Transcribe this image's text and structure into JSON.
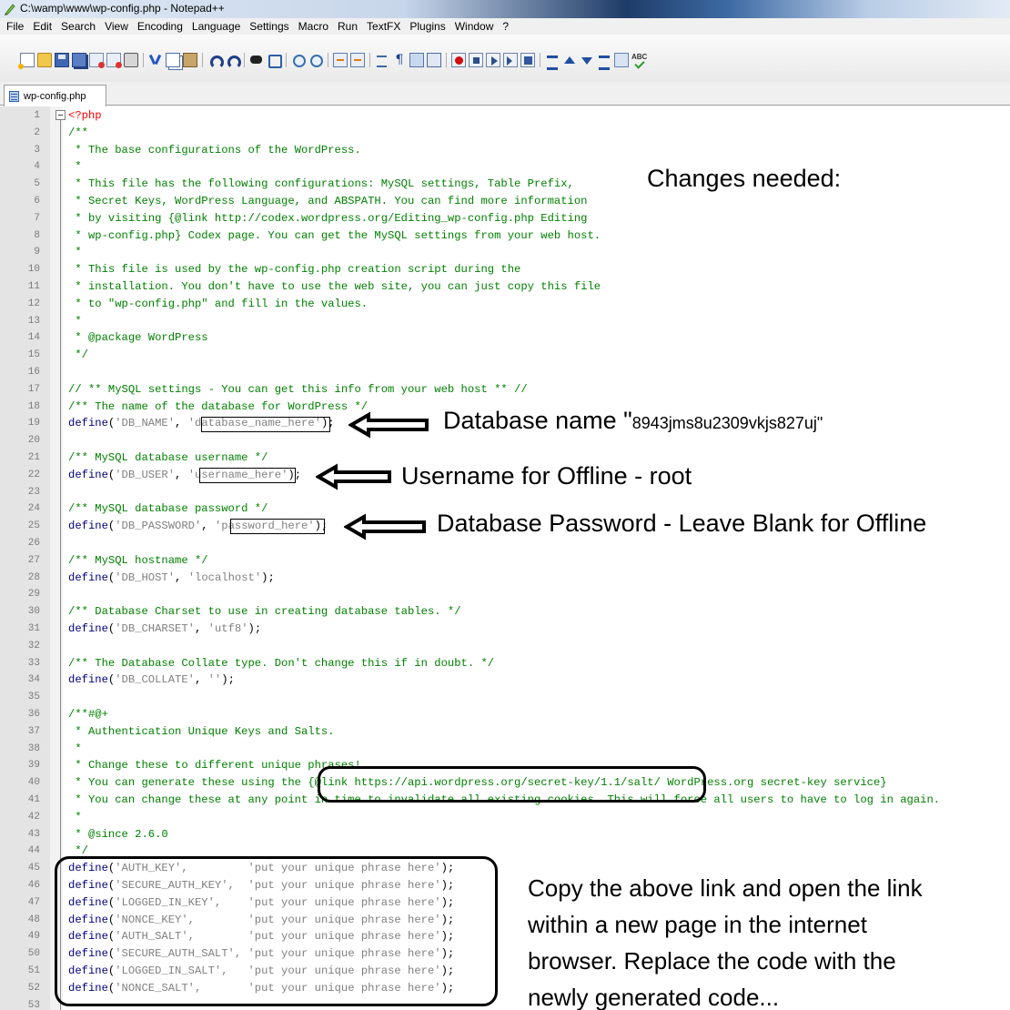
{
  "window": {
    "title": "C:\\wamp\\www\\wp-config.php - Notepad++"
  },
  "menu": [
    "File",
    "Edit",
    "Search",
    "View",
    "Encoding",
    "Language",
    "Settings",
    "Macro",
    "Run",
    "TextFX",
    "Plugins",
    "Window",
    "?"
  ],
  "toolbar": {
    "icons": [
      "new-file-icon",
      "open-file-icon",
      "save-icon",
      "save-all-icon",
      "close-icon",
      "close-all-icon",
      "print-icon",
      "cut-icon",
      "copy-icon",
      "paste-icon",
      "undo-icon",
      "redo-icon",
      "find-icon",
      "replace-icon",
      "zoom-in-icon",
      "zoom-out-icon",
      "sync-vertical-icon",
      "sync-horizontal-icon",
      "word-wrap-icon",
      "show-all-chars-icon",
      "indent-guide-icon",
      "user-language-icon",
      "record-macro-icon",
      "stop-macro-icon",
      "play-macro-icon",
      "run-macro-multiple-icon",
      "save-macro-icon",
      "sort-icon",
      "move-up-icon",
      "move-down-icon",
      "sort-lines-icon",
      "clipboard-icon",
      "spell-check-icon"
    ]
  },
  "tab": {
    "label": "wp-config.php"
  },
  "editor": {
    "lines": [
      {
        "n": "1",
        "parts": [
          [
            "php",
            "<?php"
          ]
        ]
      },
      {
        "n": "2",
        "parts": [
          [
            "comment",
            "/**"
          ]
        ]
      },
      {
        "n": "3",
        "parts": [
          [
            "comment",
            " * The base configurations of the WordPress."
          ]
        ]
      },
      {
        "n": "4",
        "parts": [
          [
            "comment",
            " *"
          ]
        ]
      },
      {
        "n": "5",
        "parts": [
          [
            "comment",
            " * This file has the following configurations: MySQL settings, Table Prefix,"
          ]
        ]
      },
      {
        "n": "6",
        "parts": [
          [
            "comment",
            " * Secret Keys, WordPress Language, and ABSPATH. You can find more information"
          ]
        ]
      },
      {
        "n": "7",
        "parts": [
          [
            "comment",
            " * by visiting {@link http://codex.wordpress.org/Editing_wp-config.php Editing"
          ]
        ]
      },
      {
        "n": "8",
        "parts": [
          [
            "comment",
            " * wp-config.php} Codex page. You can get the MySQL settings from your web host."
          ]
        ]
      },
      {
        "n": "9",
        "parts": [
          [
            "comment",
            " *"
          ]
        ]
      },
      {
        "n": "10",
        "parts": [
          [
            "comment",
            " * This file is used by the wp-config.php creation script during the"
          ]
        ]
      },
      {
        "n": "11",
        "parts": [
          [
            "comment",
            " * installation. You don't have to use the web site, you can just copy this file"
          ]
        ]
      },
      {
        "n": "12",
        "parts": [
          [
            "comment",
            " * to \"wp-config.php\" and fill in the values."
          ]
        ]
      },
      {
        "n": "13",
        "parts": [
          [
            "comment",
            " *"
          ]
        ]
      },
      {
        "n": "14",
        "parts": [
          [
            "comment",
            " * @package WordPress"
          ]
        ]
      },
      {
        "n": "15",
        "parts": [
          [
            "comment",
            " */"
          ]
        ]
      },
      {
        "n": "16",
        "parts": []
      },
      {
        "n": "17",
        "parts": [
          [
            "comment",
            "// ** MySQL settings - You can get this info from your web host ** //"
          ]
        ]
      },
      {
        "n": "18",
        "parts": [
          [
            "comment",
            "/** The name of the database for WordPress */"
          ]
        ]
      },
      {
        "n": "19",
        "parts": [
          [
            "kw",
            "define"
          ],
          [
            "plain",
            "("
          ],
          [
            "str",
            "'DB_NAME'"
          ],
          [
            "plain",
            ", "
          ],
          [
            "str",
            "'database_name_here'"
          ],
          [
            "plain",
            ");"
          ]
        ]
      },
      {
        "n": "20",
        "parts": []
      },
      {
        "n": "21",
        "parts": [
          [
            "comment",
            "/** MySQL database username */"
          ]
        ]
      },
      {
        "n": "22",
        "parts": [
          [
            "kw",
            "define"
          ],
          [
            "plain",
            "("
          ],
          [
            "str",
            "'DB_USER'"
          ],
          [
            "plain",
            ", "
          ],
          [
            "str",
            "'username_here'"
          ],
          [
            "plain",
            ");"
          ]
        ]
      },
      {
        "n": "23",
        "parts": []
      },
      {
        "n": "24",
        "parts": [
          [
            "comment",
            "/** MySQL database password */"
          ]
        ]
      },
      {
        "n": "25",
        "parts": [
          [
            "kw",
            "define"
          ],
          [
            "plain",
            "("
          ],
          [
            "str",
            "'DB_PASSWORD'"
          ],
          [
            "plain",
            ", "
          ],
          [
            "str",
            "'password_here'"
          ],
          [
            "plain",
            ");"
          ]
        ]
      },
      {
        "n": "26",
        "parts": []
      },
      {
        "n": "27",
        "parts": [
          [
            "comment",
            "/** MySQL hostname */"
          ]
        ]
      },
      {
        "n": "28",
        "parts": [
          [
            "kw",
            "define"
          ],
          [
            "plain",
            "("
          ],
          [
            "str",
            "'DB_HOST'"
          ],
          [
            "plain",
            ", "
          ],
          [
            "str",
            "'localhost'"
          ],
          [
            "plain",
            ");"
          ]
        ]
      },
      {
        "n": "29",
        "parts": []
      },
      {
        "n": "30",
        "parts": [
          [
            "comment",
            "/** Database Charset to use in creating database tables. */"
          ]
        ]
      },
      {
        "n": "31",
        "parts": [
          [
            "kw",
            "define"
          ],
          [
            "plain",
            "("
          ],
          [
            "str",
            "'DB_CHARSET'"
          ],
          [
            "plain",
            ", "
          ],
          [
            "str",
            "'utf8'"
          ],
          [
            "plain",
            ");"
          ]
        ]
      },
      {
        "n": "32",
        "parts": []
      },
      {
        "n": "33",
        "parts": [
          [
            "comment",
            "/** The Database Collate type. Don't change this if in doubt. */"
          ]
        ]
      },
      {
        "n": "34",
        "parts": [
          [
            "kw",
            "define"
          ],
          [
            "plain",
            "("
          ],
          [
            "str",
            "'DB_COLLATE'"
          ],
          [
            "plain",
            ", "
          ],
          [
            "str",
            "''"
          ],
          [
            "plain",
            ");"
          ]
        ]
      },
      {
        "n": "35",
        "parts": []
      },
      {
        "n": "36",
        "parts": [
          [
            "comment",
            "/**#@+"
          ]
        ]
      },
      {
        "n": "37",
        "parts": [
          [
            "comment",
            " * Authentication Unique Keys and Salts."
          ]
        ]
      },
      {
        "n": "38",
        "parts": [
          [
            "comment",
            " *"
          ]
        ]
      },
      {
        "n": "39",
        "parts": [
          [
            "comment",
            " * Change these to different unique phrases!"
          ]
        ]
      },
      {
        "n": "40",
        "parts": [
          [
            "comment",
            " * You can generate these using the {@link https://api.wordpress.org/secret-key/1.1/salt/ WordPress.org secret-key service}"
          ]
        ]
      },
      {
        "n": "41",
        "parts": [
          [
            "comment",
            " * You can change these at any point in time to invalidate all existing cookies. This will force all users to have to log in again."
          ]
        ]
      },
      {
        "n": "42",
        "parts": [
          [
            "comment",
            " *"
          ]
        ]
      },
      {
        "n": "43",
        "parts": [
          [
            "comment",
            " * @since 2.6.0"
          ]
        ]
      },
      {
        "n": "44",
        "parts": [
          [
            "comment",
            " */"
          ]
        ]
      },
      {
        "n": "45",
        "parts": [
          [
            "kw",
            "define"
          ],
          [
            "plain",
            "("
          ],
          [
            "str",
            "'AUTH_KEY',         'put your unique phrase here'"
          ],
          [
            "plain",
            ");"
          ]
        ]
      },
      {
        "n": "46",
        "parts": [
          [
            "kw",
            "define"
          ],
          [
            "plain",
            "("
          ],
          [
            "str",
            "'SECURE_AUTH_KEY',  'put your unique phrase here'"
          ],
          [
            "plain",
            ");"
          ]
        ]
      },
      {
        "n": "47",
        "parts": [
          [
            "kw",
            "define"
          ],
          [
            "plain",
            "("
          ],
          [
            "str",
            "'LOGGED_IN_KEY',    'put your unique phrase here'"
          ],
          [
            "plain",
            ");"
          ]
        ]
      },
      {
        "n": "48",
        "parts": [
          [
            "kw",
            "define"
          ],
          [
            "plain",
            "("
          ],
          [
            "str",
            "'NONCE_KEY',        'put your unique phrase here'"
          ],
          [
            "plain",
            ");"
          ]
        ]
      },
      {
        "n": "49",
        "parts": [
          [
            "kw",
            "define"
          ],
          [
            "plain",
            "("
          ],
          [
            "str",
            "'AUTH_SALT',        'put your unique phrase here'"
          ],
          [
            "plain",
            ");"
          ]
        ]
      },
      {
        "n": "50",
        "parts": [
          [
            "kw",
            "define"
          ],
          [
            "plain",
            "("
          ],
          [
            "str",
            "'SECURE_AUTH_SALT', 'put your unique phrase here'"
          ],
          [
            "plain",
            ");"
          ]
        ]
      },
      {
        "n": "51",
        "parts": [
          [
            "kw",
            "define"
          ],
          [
            "plain",
            "("
          ],
          [
            "str",
            "'LOGGED_IN_SALT',   'put your unique phrase here'"
          ],
          [
            "plain",
            ");"
          ]
        ]
      },
      {
        "n": "52",
        "parts": [
          [
            "kw",
            "define"
          ],
          [
            "plain",
            "("
          ],
          [
            "str",
            "'NONCE_SALT',       'put your unique phrase here'"
          ],
          [
            "plain",
            ");"
          ]
        ]
      },
      {
        "n": "53",
        "parts": []
      }
    ]
  },
  "annotations": {
    "changes_needed": "Changes needed:",
    "db_name_label": "Database name \"",
    "db_name_value": "8943jms8u2309vkjs827uj\"",
    "username_note": "Username for Offline - root",
    "password_note": "Database Password - Leave Blank for Offline",
    "instructions": [
      "Copy the above link and open the link",
      "within a new page in the internet",
      "browser. Replace the code with the",
      "newly generated code..."
    ]
  }
}
